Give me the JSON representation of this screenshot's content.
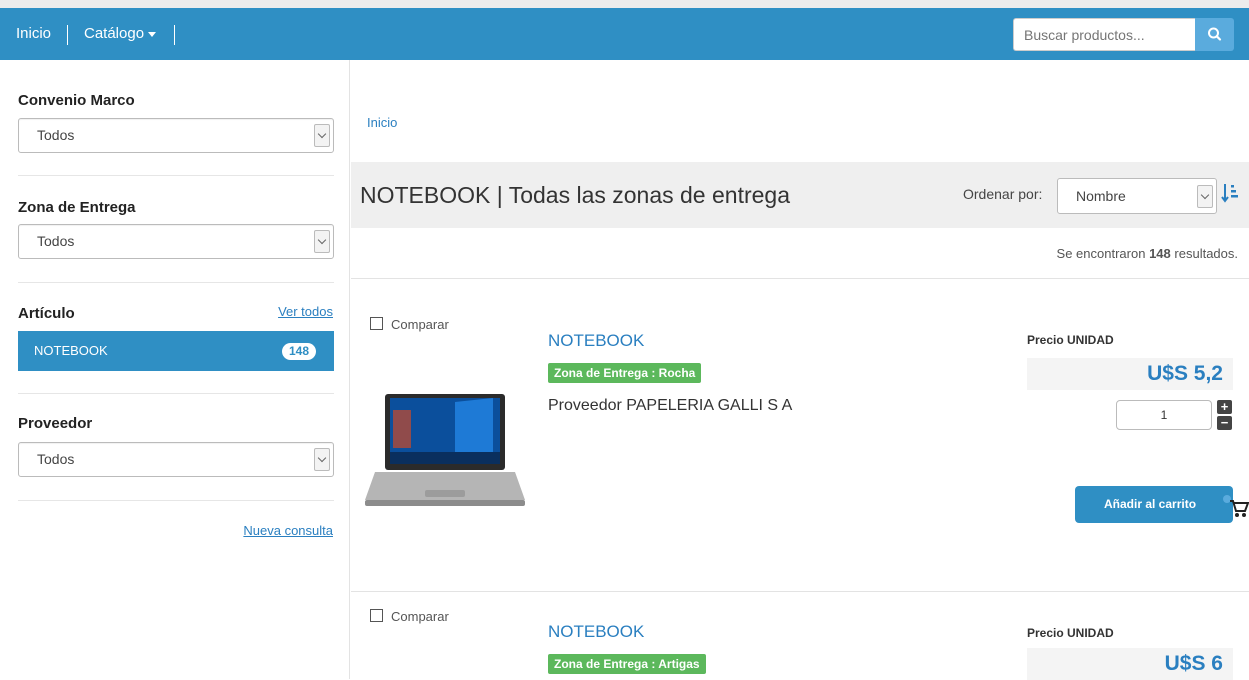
{
  "nav": {
    "home": "Inicio",
    "catalog": "Catálogo",
    "search_placeholder": "Buscar productos..."
  },
  "sidebar": {
    "convenio": {
      "label": "Convenio Marco",
      "value": "Todos"
    },
    "zona": {
      "label": "Zona de Entrega",
      "value": "Todos"
    },
    "articulo": {
      "label": "Artículo",
      "see_all": "Ver todos",
      "item": "NOTEBOOK",
      "count": "148"
    },
    "proveedor": {
      "label": "Proveedor",
      "value": "Todos"
    },
    "new_query": "Nueva consulta"
  },
  "main": {
    "breadcrumb": "Inicio",
    "title": "NOTEBOOK | Todas las zonas de entrega",
    "sort_label": "Ordenar por:",
    "sort_value": "Nombre",
    "results_prefix": "Se encontraron",
    "results_count": "148",
    "results_suffix": "resultados."
  },
  "products": [
    {
      "compare": "Comparar",
      "name": "NOTEBOOK",
      "zone": "Zona de Entrega : Rocha",
      "provider": "Proveedor PAPELERIA GALLI S A",
      "price_label": "Precio UNIDAD",
      "price": "U$S 5,2",
      "quantity": "1",
      "cart_label": "Añadir al carrito"
    },
    {
      "compare": "Comparar",
      "name": "NOTEBOOK",
      "zone": "Zona de Entrega : Artigas",
      "price_label": "Precio UNIDAD",
      "price": "U$S 6"
    }
  ],
  "colors": {
    "navbar": "#2f8fc4",
    "link": "#2a7fc0",
    "zone_badge": "#5cb85c"
  },
  "icons": {
    "search": "search-icon",
    "sort": "sort-ascending-icon",
    "cart": "cart-icon",
    "plus": "plus-icon",
    "minus": "minus-icon"
  }
}
